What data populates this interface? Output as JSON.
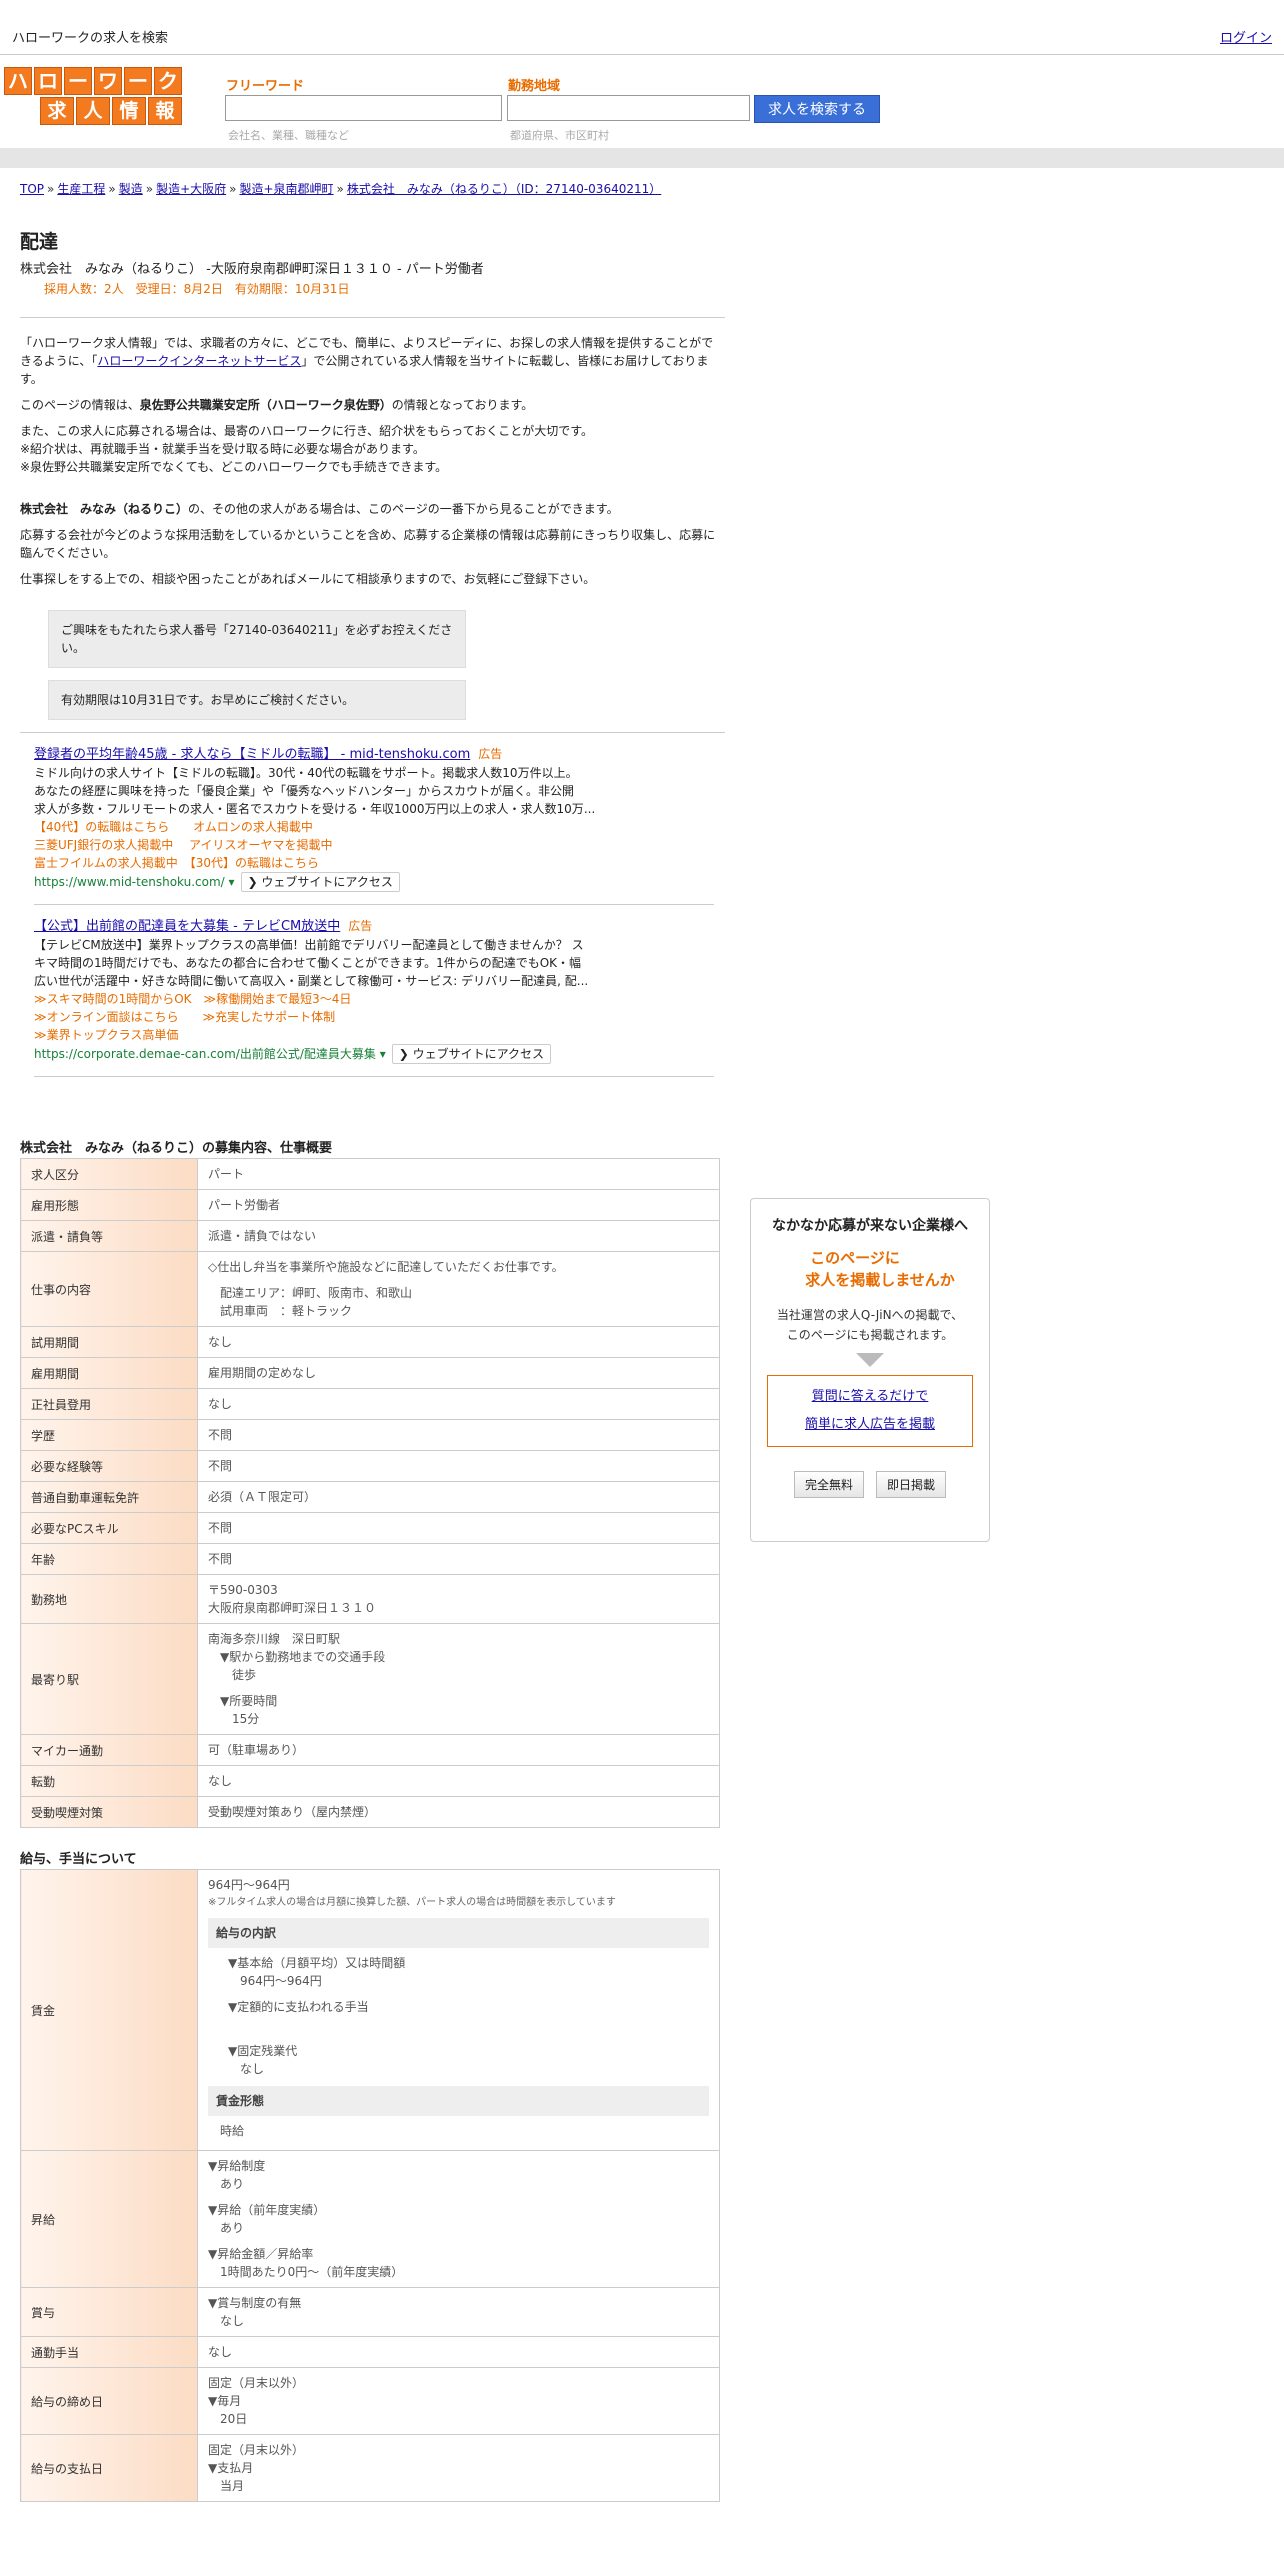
{
  "topbar": {
    "site_title": "ハローワークの求人を検索",
    "login": "ログイン"
  },
  "logo": {
    "row1": [
      "ハ",
      "ロ",
      "ー",
      "ワ",
      "ー",
      "ク"
    ],
    "row2": [
      "求",
      "人",
      "情",
      "報"
    ]
  },
  "search": {
    "freeword_label": "フリーワード",
    "freeword_hint": "会社名、業種、職種など",
    "area_label": "勤務地域",
    "area_hint": "都道府県、市区町村",
    "button": "求人を検索する"
  },
  "breadcrumb": [
    "TOP",
    "生産工程",
    "製造",
    "製造+大阪府",
    "製造+泉南郡岬町",
    "株式会社　みなみ（ねるりこ）（ID：27140-03640211）"
  ],
  "job": {
    "title": "配達",
    "subtitle": "株式会社　みなみ（ねるりこ） -大阪府泉南郡岬町深日１３１０ - パート労働者",
    "meta": "採用人数：2人　受理日：8月2日　有効期限：10月31日"
  },
  "intro": {
    "p1a": "「ハローワーク求人情報」では、求職者の方々に、どこでも、簡単に、よりスピーディに、お探しの求人情報を提供することができるように、「",
    "p1link": "ハローワークインターネットサービス",
    "p1b": "」で公開されている求人情報を当サイトに転載し、皆様にお届けしております。",
    "p2a": "このページの情報は、",
    "p2b": "泉佐野公共職業安定所（ハローワーク泉佐野）",
    "p2c": "の情報となっております。",
    "p3": "また、この求人に応募される場合は、最寄のハローワークに行き、紹介状をもらっておくことが大切です。",
    "p4": "※紹介状は、再就職手当・就業手当を受け取る時に必要な場合があります。",
    "p5": "※泉佐野公共職業安定所でなくても、どこのハローワークでも手続きできます。",
    "p6a": "株式会社　みなみ（ねるりこ）",
    "p6b": "の、その他の求人がある場合は、このページの一番下から見ることができます。",
    "p7": "応募する会社が今どのような採用活動をしているかということを含め、応募する企業様の情報は応募前にきっちり収集し、応募に臨んでください。",
    "p8": "仕事探しをする上での、相談や困ったことがあればメールにて相談承りますので、お気軽にご登録下さい。"
  },
  "notices": [
    "ご興味をもたれたら求人番号「27140-03640211」を必ずお控えください。",
    "有効期限は10月31日です。お早めにご検討ください。"
  ],
  "ads": [
    {
      "title": "登録者の平均年齢45歳 - 求人なら【ミドルの転職】 - mid-tenshoku.com",
      "badge": "広告",
      "body": [
        "ミドル向けの求人サイト【ミドルの転職】。30代・40代の転職をサポート。掲載求人数10万件以上。",
        "あなたの経歴に興味を持った「優良企業」や「優秀なヘッドハンター」からスカウトが届く。非公開",
        "求人が多数・フルリモートの求人・匿名でスカウトを受ける・年収1000万円以上の求人・求人数10万..."
      ],
      "links": [
        "【40代】の転職はこちら　　オムロンの求人掲載中",
        "三菱UFJ銀行の求人掲載中　 アイリスオーヤマを掲載中",
        "富士フイルムの求人掲載中　【30代】の転職はこちら"
      ],
      "url": "https://www.mid-tenshoku.com/",
      "visit": "❯ ウェブサイトにアクセス"
    },
    {
      "title": "【公式】出前館の配達員を大募集 - テレビCM放送中",
      "badge": "広告",
      "body": [
        "【テレビCM放送中】業界トップクラスの高単価！出前館でデリバリー配達員として働きませんか？ ス",
        "キマ時間の1時間だけでも、あなたの都合に合わせて働くことができます。1件からの配達でもOK・幅",
        "広い世代が活躍中・好きな時間に働いて高収入・副業として稼働可・サービス: デリバリー配達員, 配..."
      ],
      "links": [
        "≫スキマ時間の1時間からOK　≫稼働開始まで最短3～4日",
        "≫オンライン面談はこちら　　≫充実したサポート体制",
        "≫業界トップクラス高単価"
      ],
      "url": "https://corporate.demae-can.com/出前館公式/配達員大募集",
      "visit": "❯ ウェブサイトにアクセス"
    }
  ],
  "overview": {
    "title": "株式会社　みなみ（ねるりこ）の募集内容、仕事概要",
    "rows": [
      {
        "k": "求人区分",
        "v": [
          "パート"
        ]
      },
      {
        "k": "雇用形態",
        "v": [
          "パート労働者"
        ]
      },
      {
        "k": "派遣・請負等",
        "v": [
          "派遣・請負ではない"
        ]
      },
      {
        "k": "仕事の内容",
        "v": [
          "◇仕出し弁当を事業所や施設などに配達していただくお仕事です。",
          "",
          "　配達エリア：岬町、阪南市、和歌山",
          "　試用車両　：軽トラック"
        ]
      },
      {
        "k": "試用期間",
        "v": [
          "なし"
        ]
      },
      {
        "k": "雇用期間",
        "v": [
          "雇用期間の定めなし"
        ]
      },
      {
        "k": "正社員登用",
        "v": [
          "なし"
        ]
      },
      {
        "k": "学歴",
        "v": [
          "不問"
        ]
      },
      {
        "k": "必要な経験等",
        "v": [
          "不問"
        ]
      },
      {
        "k": "普通自動車運転免許",
        "v": [
          "必須（ＡＴ限定可）"
        ]
      },
      {
        "k": "必要なPCスキル",
        "v": [
          "不問"
        ]
      },
      {
        "k": "年齢",
        "v": [
          "不問"
        ]
      },
      {
        "k": "勤務地",
        "v": [
          "〒590-0303",
          "大阪府泉南郡岬町深日１３１０"
        ]
      },
      {
        "k": "最寄り駅",
        "v": [
          "南海多奈川線　深日町駅",
          "　▼駅から勤務地までの交通手段",
          "　　徒歩",
          "",
          "　▼所要時間",
          "　　15分"
        ]
      },
      {
        "k": "マイカー通勤",
        "v": [
          "可（駐車場あり）"
        ]
      },
      {
        "k": "転勤",
        "v": [
          "なし"
        ]
      },
      {
        "k": "受動喫煙対策",
        "v": [
          "受動喫煙対策あり（屋内禁煙）"
        ]
      }
    ]
  },
  "salary": {
    "title": "給与、手当について",
    "wage_label": "賃金",
    "wage_value": "964円〜964円",
    "wage_note": "※フルタイム求人の場合は月額に換算した額、パート求人の場合は時間額を表示しています",
    "breakdown_title": "給与の内訳",
    "breakdown": [
      {
        "h": "▼基本給（月額平均）又は時間額",
        "v": "964円〜964円"
      },
      {
        "h": "▼定額的に支払われる手当",
        "v": ""
      },
      {
        "h": "▼固定残業代",
        "v": "なし"
      }
    ],
    "form_title": "賃金形態",
    "form_value": "時給",
    "rows": [
      {
        "k": "昇給",
        "v": [
          "▼昇給制度",
          "　あり",
          "",
          "▼昇給（前年度実績）",
          "　あり",
          "",
          "▼昇給金額／昇給率",
          "　1時間あたり0円〜（前年度実績）"
        ]
      },
      {
        "k": "賞与",
        "v": [
          "▼賞与制度の有無",
          "　なし"
        ]
      },
      {
        "k": "通勤手当",
        "v": [
          "なし"
        ]
      },
      {
        "k": "給与の締め日",
        "v": [
          "固定（月末以外）",
          "▼毎月",
          "　20日"
        ]
      },
      {
        "k": "給与の支払日",
        "v": [
          "固定（月末以外）",
          "▼支払月",
          "　当月"
        ]
      }
    ]
  },
  "side": {
    "head": "なかなか応募が来ない企業様へ",
    "orange1": "このページに",
    "orange2": "求人を掲載しませんか",
    "body1": "当社運営の求人Q-JiNへの掲載で、",
    "body2": "このページにも掲載されます。",
    "link1": "質問に答えるだけで",
    "link2": "簡単に求人広告を掲載",
    "btn1": "完全無料",
    "btn2": "即日掲載"
  }
}
